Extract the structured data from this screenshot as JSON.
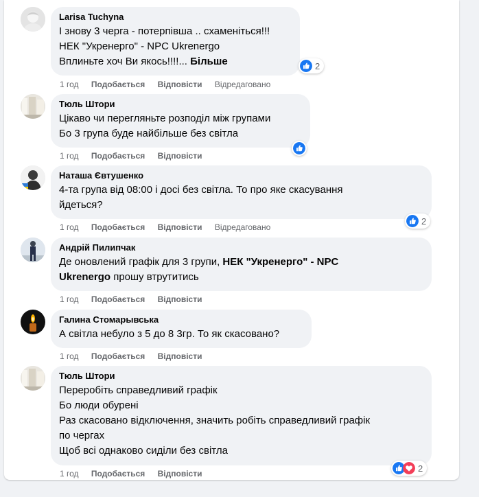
{
  "labels": {
    "like": "Подобається",
    "reply": "Відповісти",
    "edited": "Відредаговано"
  },
  "colors": {
    "like_blue": "#1877f2",
    "love_red": "#f33e58",
    "bubble_bg": "#f0f2f5",
    "meta_gray": "#65676b"
  },
  "comments": [
    {
      "author": "Larisa Tuchyna",
      "line1": "І знову 3 черга - потерпівша .. схаменіться!!!",
      "line2": "НЕК \"Укренерго\" - NPC Ukrenergo",
      "line3": "Вплиньте хоч Ви якось!!!!...",
      "more": "Більше",
      "time": "1 год",
      "reactions": [
        "like-icon"
      ],
      "reaction_count": "2"
    },
    {
      "author": "Тюль Штори",
      "line1": "Цікаво чи перегляньте розподіл між групами",
      "line2": "Бо 3 група буде найбільше без світла",
      "time": "1 год",
      "reactions": [
        "like-icon"
      ]
    },
    {
      "author": "Наташа Євтушенко",
      "line1": "4-та група від 08:00 і досі без світла. То про яке скасування",
      "line2": "йдеться?",
      "time": "1 год",
      "reactions": [
        "like-icon"
      ],
      "reaction_count": "2"
    },
    {
      "author": "Андрій Пилипчак",
      "line1_pre": "Де оновлений графік для 3 групи, ",
      "line1_tag": "НЕК \"Укренерго\" - NPC",
      "line2_tag": "Ukrenergo",
      "line2_post": " прошу втрутитись",
      "time": "1 год"
    },
    {
      "author": "Галина Стомарывська",
      "line1": "А світла небуло з 5 до 8 3гр. То як скасовано?",
      "time": "1 год"
    },
    {
      "author": "Тюль Штори",
      "line1": "Переробіть справедливий графік",
      "line2": "Бо люди обурені",
      "line3": "Раз скасовано відключення, значить робіть справедливий графік",
      "line4": "по чергах",
      "line5": "Щоб всі однаково сиділи без світла",
      "time": "1 год",
      "reactions": [
        "like-icon",
        "love-icon"
      ],
      "reaction_count": "2"
    }
  ]
}
